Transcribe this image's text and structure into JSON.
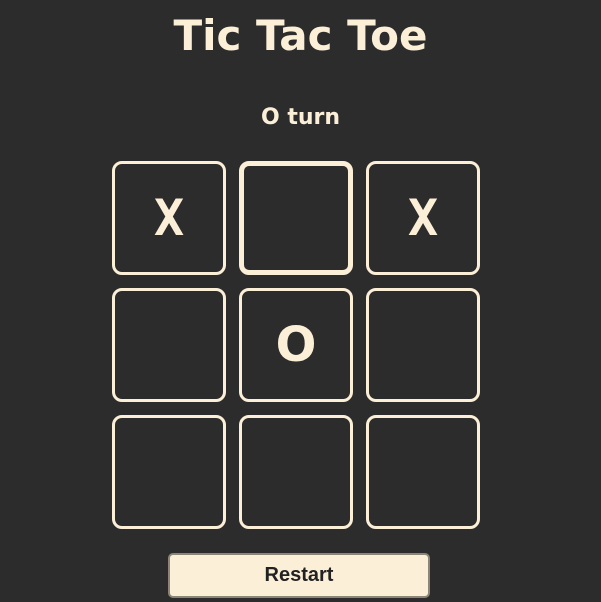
{
  "title": "Tic Tac Toe",
  "status": "O turn",
  "board": {
    "cells": [
      "X",
      "",
      "X",
      "",
      "O",
      "",
      "",
      "",
      ""
    ],
    "active_cell": 1
  },
  "restart_label": "Restart",
  "colors": {
    "background": "#2c2c2c",
    "accent": "#fcefd8",
    "button_text": "#222222"
  }
}
